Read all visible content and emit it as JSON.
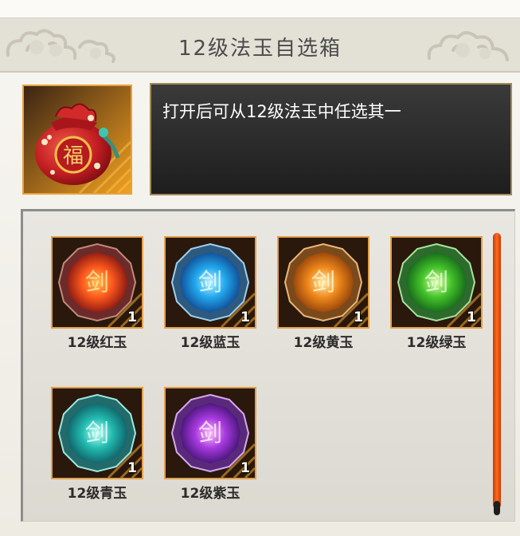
{
  "dialog": {
    "title": "12级法玉自选箱"
  },
  "item": {
    "icon": "lucky-bag-icon",
    "description": "打开后可从12级法玉中任选其一"
  },
  "gems": [
    {
      "label": "12级红玉",
      "count": "1",
      "icon": "red-jade-icon",
      "color": "#d43a1c"
    },
    {
      "label": "12级蓝玉",
      "count": "1",
      "icon": "blue-jade-icon",
      "color": "#1f9be0"
    },
    {
      "label": "12级黄玉",
      "count": "1",
      "icon": "yellow-jade-icon",
      "color": "#e68a1e"
    },
    {
      "label": "12级绿玉",
      "count": "1",
      "icon": "green-jade-icon",
      "color": "#3fbf2a"
    },
    {
      "label": "12级青玉",
      "count": "1",
      "icon": "cyan-jade-icon",
      "color": "#21b8b0"
    },
    {
      "label": "12级紫玉",
      "count": "1",
      "icon": "purple-jade-icon",
      "color": "#9b3ad8"
    }
  ]
}
